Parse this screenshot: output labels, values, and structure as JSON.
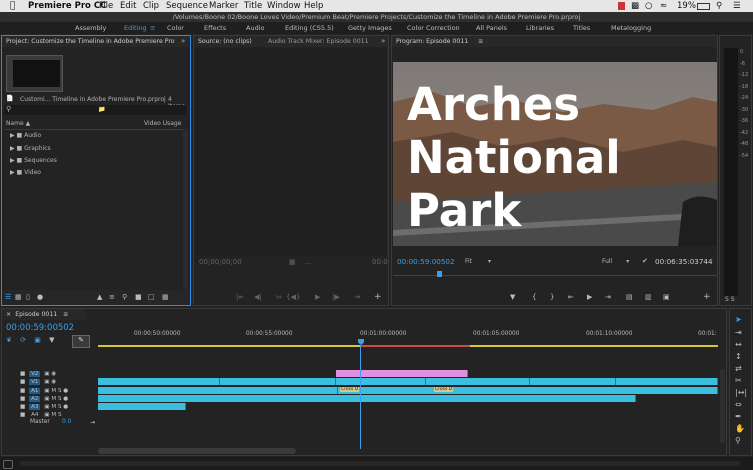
{
  "menubar": {
    "app_name": "Premiere Pro CC",
    "items": [
      "File",
      "Edit",
      "Clip",
      "Sequence",
      "Marker",
      "Title",
      "Window",
      "Help"
    ],
    "battery": "19%",
    "clock": "",
    "icons": [
      "apple-icon",
      "wifi-icon",
      "battery-icon",
      "search-icon",
      "list-icon"
    ]
  },
  "path": "/Volumes/Boone 02/Boone Loves Video/Premium Beat/Premiere Projects/Customize the Timeline in Adobe Premiere Pro.prproj",
  "workspaces": {
    "items": [
      "Assembly",
      "Editing",
      "Color",
      "Effects",
      "Audio",
      "Editing (CS5.5)",
      "Getty Images",
      "Color Correction",
      "All Panels",
      "Libraries",
      "Titles",
      "Metalogging"
    ],
    "active": "Editing"
  },
  "project": {
    "tab": "Project: Customize the Timeline in Adobe Premiere Pro",
    "file": "Customi... Timeline in Adobe Premiere Pro.prproj",
    "count": "4 Items",
    "col_name": "Name",
    "col_usage": "Video Usage",
    "bins": [
      "Audio",
      "Graphics",
      "Sequences",
      "Video"
    ]
  },
  "source": {
    "tab": "Source: (no clips)",
    "tab2": "Audio Track Mixer: Episode 0011",
    "timecode": "00;00;00;00",
    "timecode_right": "00:0"
  },
  "program": {
    "tab": "Program: Episode 0011",
    "title_line1": "Arches",
    "title_line2": "National",
    "title_line3": "Park",
    "timecode": "00:00:59:00502",
    "fit": "Fit",
    "quality": "Full",
    "duration": "00:06:35:03744"
  },
  "timeline": {
    "tab": "Episode 0011",
    "timecode": "00:00:59:00502",
    "ruler": [
      "00:00:50:00000",
      "00:00:55:00000",
      "00:01:00:00000",
      "00:01:05:00000",
      "00:01:10:00000",
      "00:01:"
    ],
    "tracks": [
      "V2",
      "V1",
      "A1",
      "A2",
      "A3",
      "A4"
    ],
    "master_label": "Master",
    "master_value": "0.0",
    "clip_label": "Cross D"
  },
  "meter": {
    "ticks": [
      "0",
      "-6",
      "-12",
      "-18",
      "-24",
      "-30",
      "-36",
      "-42",
      "-48",
      "-54"
    ]
  },
  "colors": {
    "accent": "#2d8ceb",
    "timecode_blue": "#3d9ee8",
    "clip_video": "#3bbfe0",
    "clip_title": "#e28fe0",
    "workarea_yellow": "#d4c73a",
    "in_out_red": "#c84a4a"
  }
}
